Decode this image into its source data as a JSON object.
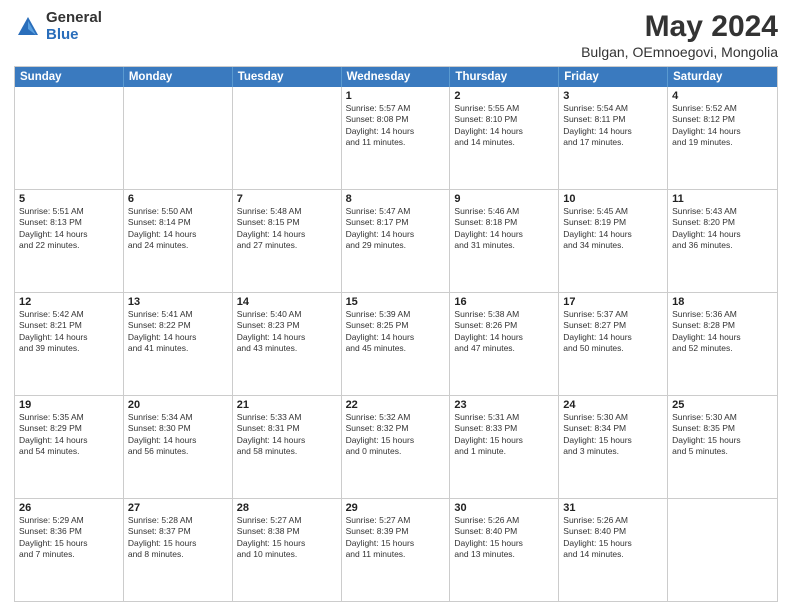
{
  "logo": {
    "general": "General",
    "blue": "Blue"
  },
  "title": "May 2024",
  "subtitle": "Bulgan, OEmnoegovi, Mongolia",
  "days": [
    "Sunday",
    "Monday",
    "Tuesday",
    "Wednesday",
    "Thursday",
    "Friday",
    "Saturday"
  ],
  "weeks": [
    [
      {
        "day": "",
        "info": ""
      },
      {
        "day": "",
        "info": ""
      },
      {
        "day": "",
        "info": ""
      },
      {
        "day": "1",
        "info": "Sunrise: 5:57 AM\nSunset: 8:08 PM\nDaylight: 14 hours\nand 11 minutes."
      },
      {
        "day": "2",
        "info": "Sunrise: 5:55 AM\nSunset: 8:10 PM\nDaylight: 14 hours\nand 14 minutes."
      },
      {
        "day": "3",
        "info": "Sunrise: 5:54 AM\nSunset: 8:11 PM\nDaylight: 14 hours\nand 17 minutes."
      },
      {
        "day": "4",
        "info": "Sunrise: 5:52 AM\nSunset: 8:12 PM\nDaylight: 14 hours\nand 19 minutes."
      }
    ],
    [
      {
        "day": "5",
        "info": "Sunrise: 5:51 AM\nSunset: 8:13 PM\nDaylight: 14 hours\nand 22 minutes."
      },
      {
        "day": "6",
        "info": "Sunrise: 5:50 AM\nSunset: 8:14 PM\nDaylight: 14 hours\nand 24 minutes."
      },
      {
        "day": "7",
        "info": "Sunrise: 5:48 AM\nSunset: 8:15 PM\nDaylight: 14 hours\nand 27 minutes."
      },
      {
        "day": "8",
        "info": "Sunrise: 5:47 AM\nSunset: 8:17 PM\nDaylight: 14 hours\nand 29 minutes."
      },
      {
        "day": "9",
        "info": "Sunrise: 5:46 AM\nSunset: 8:18 PM\nDaylight: 14 hours\nand 31 minutes."
      },
      {
        "day": "10",
        "info": "Sunrise: 5:45 AM\nSunset: 8:19 PM\nDaylight: 14 hours\nand 34 minutes."
      },
      {
        "day": "11",
        "info": "Sunrise: 5:43 AM\nSunset: 8:20 PM\nDaylight: 14 hours\nand 36 minutes."
      }
    ],
    [
      {
        "day": "12",
        "info": "Sunrise: 5:42 AM\nSunset: 8:21 PM\nDaylight: 14 hours\nand 39 minutes."
      },
      {
        "day": "13",
        "info": "Sunrise: 5:41 AM\nSunset: 8:22 PM\nDaylight: 14 hours\nand 41 minutes."
      },
      {
        "day": "14",
        "info": "Sunrise: 5:40 AM\nSunset: 8:23 PM\nDaylight: 14 hours\nand 43 minutes."
      },
      {
        "day": "15",
        "info": "Sunrise: 5:39 AM\nSunset: 8:25 PM\nDaylight: 14 hours\nand 45 minutes."
      },
      {
        "day": "16",
        "info": "Sunrise: 5:38 AM\nSunset: 8:26 PM\nDaylight: 14 hours\nand 47 minutes."
      },
      {
        "day": "17",
        "info": "Sunrise: 5:37 AM\nSunset: 8:27 PM\nDaylight: 14 hours\nand 50 minutes."
      },
      {
        "day": "18",
        "info": "Sunrise: 5:36 AM\nSunset: 8:28 PM\nDaylight: 14 hours\nand 52 minutes."
      }
    ],
    [
      {
        "day": "19",
        "info": "Sunrise: 5:35 AM\nSunset: 8:29 PM\nDaylight: 14 hours\nand 54 minutes."
      },
      {
        "day": "20",
        "info": "Sunrise: 5:34 AM\nSunset: 8:30 PM\nDaylight: 14 hours\nand 56 minutes."
      },
      {
        "day": "21",
        "info": "Sunrise: 5:33 AM\nSunset: 8:31 PM\nDaylight: 14 hours\nand 58 minutes."
      },
      {
        "day": "22",
        "info": "Sunrise: 5:32 AM\nSunset: 8:32 PM\nDaylight: 15 hours\nand 0 minutes."
      },
      {
        "day": "23",
        "info": "Sunrise: 5:31 AM\nSunset: 8:33 PM\nDaylight: 15 hours\nand 1 minute."
      },
      {
        "day": "24",
        "info": "Sunrise: 5:30 AM\nSunset: 8:34 PM\nDaylight: 15 hours\nand 3 minutes."
      },
      {
        "day": "25",
        "info": "Sunrise: 5:30 AM\nSunset: 8:35 PM\nDaylight: 15 hours\nand 5 minutes."
      }
    ],
    [
      {
        "day": "26",
        "info": "Sunrise: 5:29 AM\nSunset: 8:36 PM\nDaylight: 15 hours\nand 7 minutes."
      },
      {
        "day": "27",
        "info": "Sunrise: 5:28 AM\nSunset: 8:37 PM\nDaylight: 15 hours\nand 8 minutes."
      },
      {
        "day": "28",
        "info": "Sunrise: 5:27 AM\nSunset: 8:38 PM\nDaylight: 15 hours\nand 10 minutes."
      },
      {
        "day": "29",
        "info": "Sunrise: 5:27 AM\nSunset: 8:39 PM\nDaylight: 15 hours\nand 11 minutes."
      },
      {
        "day": "30",
        "info": "Sunrise: 5:26 AM\nSunset: 8:40 PM\nDaylight: 15 hours\nand 13 minutes."
      },
      {
        "day": "31",
        "info": "Sunrise: 5:26 AM\nSunset: 8:40 PM\nDaylight: 15 hours\nand 14 minutes."
      },
      {
        "day": "",
        "info": ""
      }
    ]
  ]
}
